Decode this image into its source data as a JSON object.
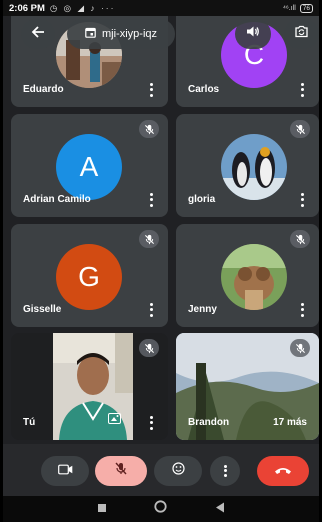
{
  "status_bar": {
    "time": "2:06 PM",
    "notification_icons": "◷ ◎ ◢ ♪ ···",
    "signal": "⁴⁶.ıll",
    "battery": "76"
  },
  "header": {
    "meeting_code": "mji-xiyp-iqz"
  },
  "participants": [
    {
      "name": "Eduardo",
      "type": "photo"
    },
    {
      "name": "Carlos",
      "type": "initial",
      "initial": "C",
      "color": "#a142f4"
    },
    {
      "name": "Adrian Camilo",
      "type": "initial",
      "initial": "A",
      "color": "#1a8fe3",
      "muted": true
    },
    {
      "name": "gloria",
      "type": "photo",
      "muted": true
    },
    {
      "name": "Gisselle",
      "type": "initial",
      "initial": "G",
      "color": "#d24b12",
      "muted": true
    },
    {
      "name": "Jenny",
      "type": "photo",
      "muted": true
    },
    {
      "name": "Tú",
      "type": "self-video",
      "muted": true
    },
    {
      "name": "Brandon",
      "type": "video",
      "muted": true,
      "extra": "17 más"
    }
  ],
  "colors": {
    "background": "#202124",
    "tile": "#3c4043",
    "end_call": "#ea4335",
    "mic_off": "#f6aea9"
  },
  "icons": {
    "back": "arrow-left-icon",
    "meeting": "calendar-icon",
    "speaker": "speaker-icon",
    "switch_camera": "camera-switch-icon",
    "muted": "mic-off-icon",
    "camera": "videocam-icon",
    "emoji": "emoji-icon",
    "more": "more-vert-icon",
    "end_call": "call-end-icon"
  }
}
